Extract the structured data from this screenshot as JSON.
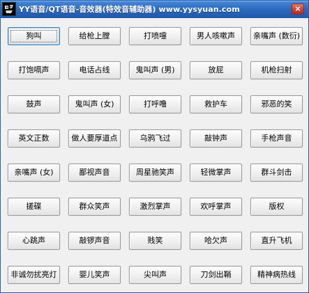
{
  "window": {
    "title": "YY语音/QT语音-音效器(特效音辅助器) www.yysyuan.com",
    "close_label": "×",
    "icon": "app-logo-icon"
  },
  "buttons": [
    [
      "狗叫",
      "给枪上膛",
      "打喷嚏",
      "男人咳嗽声",
      "亲嘴声 (数衍)"
    ],
    [
      "打饱嗝声",
      "电话占线",
      "鬼叫声 (男)",
      "放屁",
      "机枪扫射"
    ],
    [
      "鼓声",
      "鬼叫声 (女)",
      "打呼噜",
      "救护车",
      "邪恶的笑"
    ],
    [
      "英文正数",
      "做人要厚道点",
      "乌鸦飞过",
      "敲钟声",
      "手枪声音"
    ],
    [
      "亲嘴声 (女)",
      "鄙视声音",
      "周星驰笑声",
      "轻微掌声",
      "群斗剑击"
    ],
    [
      "搓碟",
      "群众笑声",
      "激烈掌声",
      "欢呼掌声",
      "版权"
    ],
    [
      "心跳声",
      "敲锣声音",
      "贱笑",
      "哈欠声",
      "直升飞机"
    ],
    [
      "非诚勿扰亮灯",
      "婴儿笑声",
      "尖叫声",
      "刀剑出鞘",
      "精神病热线"
    ]
  ],
  "focused": {
    "row": 0,
    "col": 0
  }
}
